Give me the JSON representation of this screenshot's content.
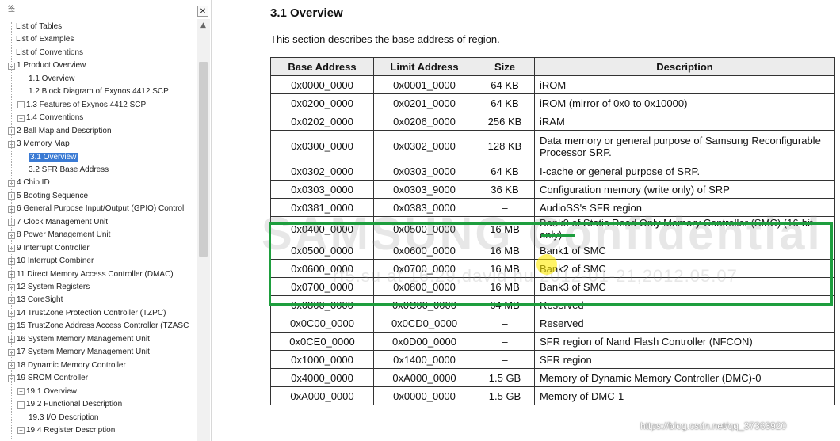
{
  "sidebar": {
    "header_label": "签",
    "close_symbol": "✕",
    "scroll_up_symbol": "▲",
    "items": [
      {
        "label": "List of Tables",
        "expander": ""
      },
      {
        "label": "List of Examples",
        "expander": ""
      },
      {
        "label": "List of Conventions",
        "expander": ""
      },
      {
        "label": "1 Product Overview",
        "expander": "−"
      },
      {
        "label": "1.1 Overview",
        "expander": ""
      },
      {
        "label": "1.2 Block Diagram of Exynos 4412 SCP",
        "expander": ""
      },
      {
        "label": "1.3 Features of Exynos 4412 SCP",
        "expander": "+"
      },
      {
        "label": "1.4 Conventions",
        "expander": "+"
      },
      {
        "label": "2 Ball Map and Description",
        "expander": "+"
      },
      {
        "label": "3 Memory Map",
        "expander": "−"
      },
      {
        "label": "3.1 Overview",
        "expander": "",
        "selected": true
      },
      {
        "label": "3.2 SFR Base Address",
        "expander": ""
      },
      {
        "label": "4 Chip ID",
        "expander": "+"
      },
      {
        "label": "5 Booting Sequence",
        "expander": "+"
      },
      {
        "label": "6 General Purpose Input/Output (GPIO) Control",
        "expander": "+"
      },
      {
        "label": "7 Clock Management Unit",
        "expander": "+"
      },
      {
        "label": "8 Power Management Unit",
        "expander": "+"
      },
      {
        "label": "9 Interrupt Controller",
        "expander": "+"
      },
      {
        "label": "10 Interrupt Combiner",
        "expander": "+"
      },
      {
        "label": "11 Direct Memory Access Controller (DMAC)",
        "expander": "+"
      },
      {
        "label": "12 System Registers",
        "expander": "+"
      },
      {
        "label": "13 CoreSight",
        "expander": "+"
      },
      {
        "label": "14 TrustZone Protection Controller (TZPC)",
        "expander": "+"
      },
      {
        "label": "15 TrustZone Address Access Controller (TZASC",
        "expander": "+"
      },
      {
        "label": "16 System Memory Management Unit",
        "expander": "+"
      },
      {
        "label": "17 System Memory Management Unit",
        "expander": "+"
      },
      {
        "label": "18 Dynamic Memory Controller",
        "expander": "+"
      },
      {
        "label": "19 SROM Controller",
        "expander": "−"
      },
      {
        "label": "19.1 Overview",
        "expander": "+"
      },
      {
        "label": "19.2 Functional Description",
        "expander": "+"
      },
      {
        "label": "19.3 I/O Description",
        "expander": ""
      },
      {
        "label": "19.4 Register Description",
        "expander": "+"
      }
    ]
  },
  "doc": {
    "title": "3.1 Overview",
    "description": "This section describes the base address of region.",
    "columns": [
      "Base Address",
      "Limit Address",
      "Size",
      "Description"
    ],
    "rows": [
      {
        "base": "0x0000_0000",
        "limit": "0x0001_0000",
        "size": "64 KB",
        "desc": "iROM"
      },
      {
        "base": "0x0200_0000",
        "limit": "0x0201_0000",
        "size": "64 KB",
        "desc": "iROM (mirror of 0x0 to 0x10000)"
      },
      {
        "base": "0x0202_0000",
        "limit": "0x0206_0000",
        "size": "256 KB",
        "desc": "iRAM"
      },
      {
        "base": "0x0300_0000",
        "limit": "0x0302_0000",
        "size": "128 KB",
        "desc": "Data memory or general purpose of Samsung Reconfigurable Processor SRP."
      },
      {
        "base": "0x0302_0000",
        "limit": "0x0303_0000",
        "size": "64 KB",
        "desc": "I-cache or general purpose of SRP."
      },
      {
        "base": "0x0303_0000",
        "limit": "0x0303_9000",
        "size": "36 KB",
        "desc": "Configuration memory (write only) of SRP"
      },
      {
        "base": "0x0381_0000",
        "limit": "0x0383_0000",
        "size": "–",
        "desc": "AudioSS's SFR region"
      },
      {
        "base": "0x0400_0000",
        "limit": "0x0500_0000",
        "size": "16 MB",
        "desc": "Bank0 of Static Read Only Memory Controller (SMC) (16-bit only)"
      },
      {
        "base": "0x0500_0000",
        "limit": "0x0600_0000",
        "size": "16 MB",
        "desc": "Bank1 of SMC"
      },
      {
        "base": "0x0600_0000",
        "limit": "0x0700_0000",
        "size": "16 MB",
        "desc": "Bank2 of SMC"
      },
      {
        "base": "0x0700_0000",
        "limit": "0x0800_0000",
        "size": "16 MB",
        "desc": "Bank3 of SMC"
      },
      {
        "base": "0x0800_0000",
        "limit": "0x0C00_0000",
        "size": "64 MB",
        "desc": "Reserved"
      },
      {
        "base": "0x0C00_0000",
        "limit": "0x0CD0_0000",
        "size": "–",
        "desc": "Reserved"
      },
      {
        "base": "0x0CE0_0000",
        "limit": "0x0D00_0000",
        "size": "–",
        "desc": "SFR region of Nand Flash Controller (NFCON)"
      },
      {
        "base": "0x1000_0000",
        "limit": "0x1400_0000",
        "size": "–",
        "desc": "SFR region"
      },
      {
        "base": "0x4000_0000",
        "limit": "0xA000_0000",
        "size": "1.5 GB",
        "desc": "Memory of Dynamic Memory Controller (DMC)-0"
      },
      {
        "base": "0xA000_0000",
        "limit": "0x0000_0000",
        "size": "1.5 GB",
        "desc": "Memory of DMC-1"
      }
    ],
    "watermark_main": "SAMSUNG Confidential",
    "watermark_sub": "rf5.su at 16:29,david hu 2012-01-21,2012.05.07"
  },
  "credit": "https://blog.csdn.net/qq_37363920",
  "colors": {
    "highlight_box": "#1e9e3e",
    "selection": "#3b7bd4",
    "cursor": "#ffeb00"
  }
}
